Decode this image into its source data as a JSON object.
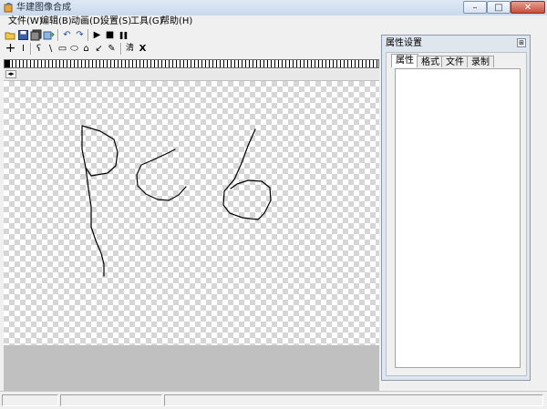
{
  "window": {
    "title": "华建图像合成",
    "min": "–",
    "max": "□",
    "close": "✕"
  },
  "menu": [
    {
      "label": "文件(W)"
    },
    {
      "label": "编辑(B)"
    },
    {
      "label": "动画(D)"
    },
    {
      "label": "设置(S)"
    },
    {
      "label": "工具(G)"
    },
    {
      "label": "帮助(H)"
    }
  ],
  "toolbar1": {
    "icons": [
      "open-icon",
      "save-icon",
      "save-all-icon",
      "export-icon",
      "undo-icon",
      "redo-icon",
      "play-icon",
      "stop-icon",
      "pause-icon"
    ],
    "glyphs": {
      "undo": "↶",
      "redo": "↷",
      "play": "▶",
      "stop": "■",
      "pause": "❚❚"
    }
  },
  "toolbar2": {
    "glyphs": {
      "move": "+",
      "text": "I",
      "curve": "ʕ",
      "line": "\\",
      "rect": "▭",
      "ellipse": "⬭",
      "shape": "⌂",
      "arrow": "↙",
      "brush": "✎",
      "clear": "清",
      "delete": "X"
    }
  },
  "panel": {
    "title": "属性设置",
    "pin": "⊞",
    "tabs": [
      {
        "label": "属性"
      },
      {
        "label": "格式"
      },
      {
        "label": "文件"
      },
      {
        "label": "录制"
      }
    ],
    "active_tab": "属性"
  },
  "colors": {
    "canvas_checker": "#d6d6d6",
    "stroke": "#000000",
    "workspace": "#c0c0c0"
  }
}
